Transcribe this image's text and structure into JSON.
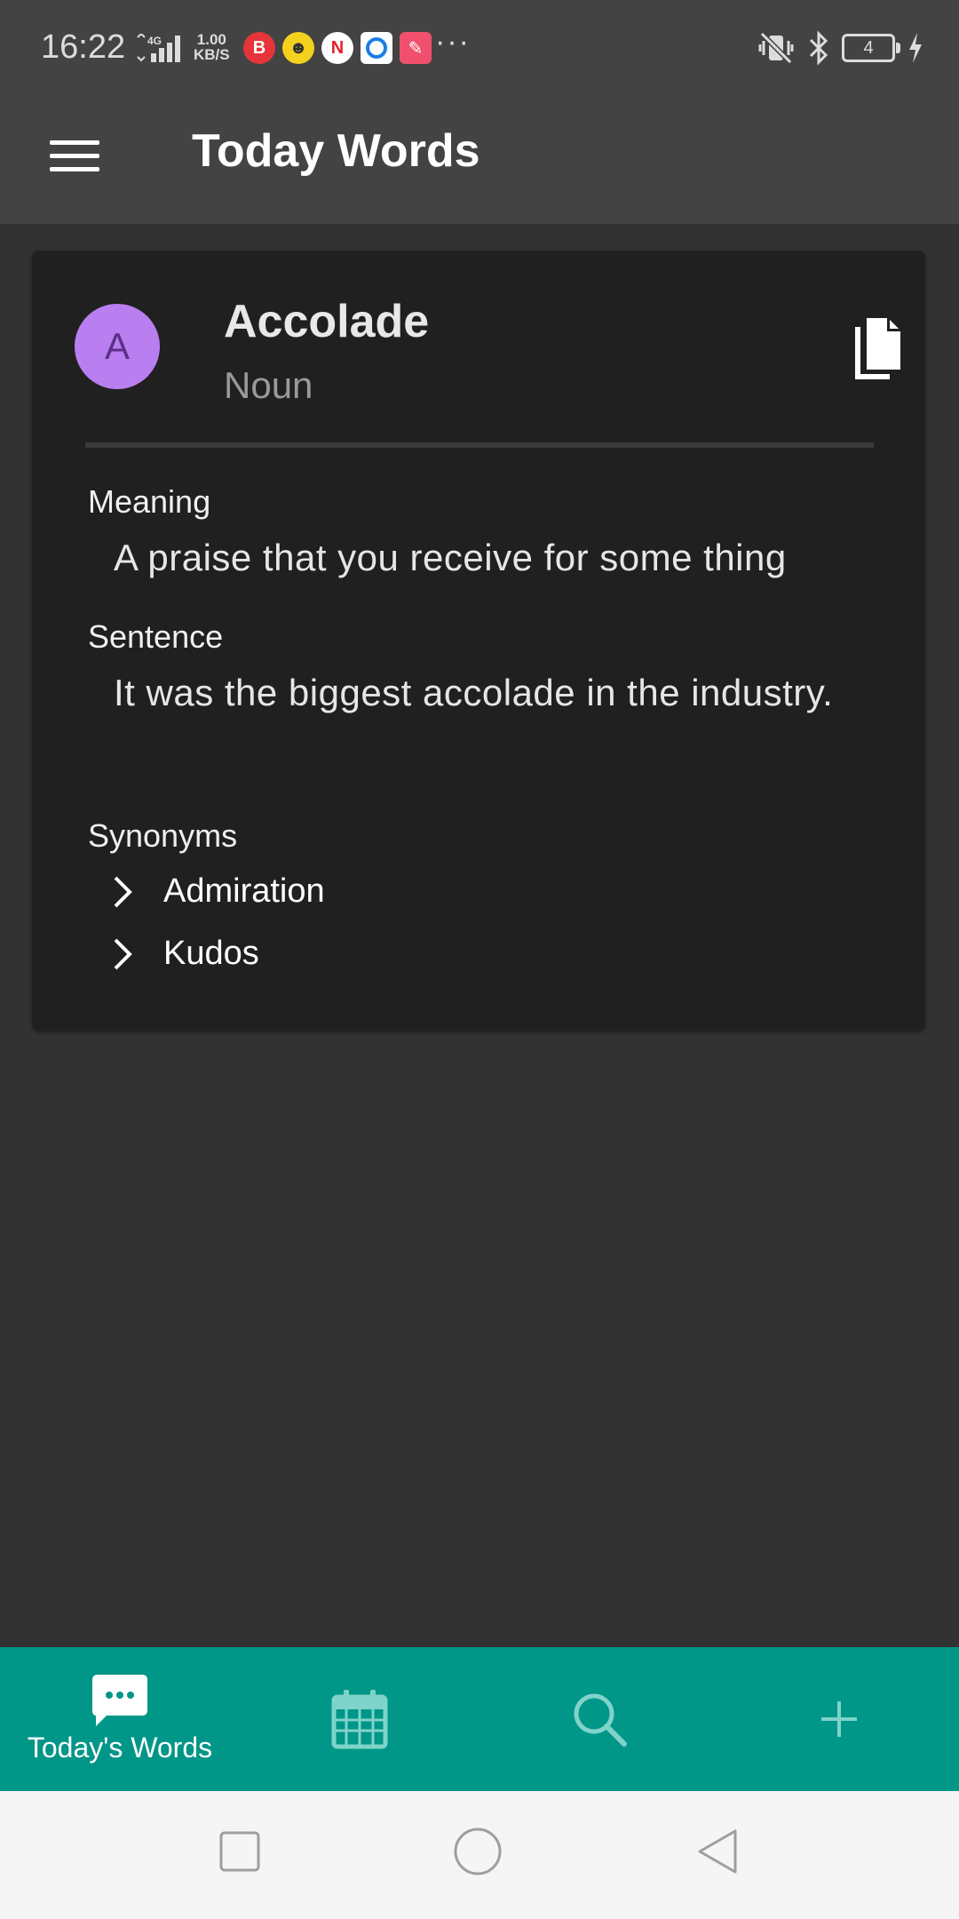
{
  "status_bar": {
    "time": "16:22",
    "speed_value": "1.00",
    "speed_unit": "KB/S",
    "net_label": "4G",
    "battery": "4",
    "more": "···"
  },
  "app_bar": {
    "title": "Today Words"
  },
  "word_card": {
    "avatar_letter": "A",
    "avatar_color": "#b97ef0",
    "word": "Accolade",
    "part_of_speech": "Noun",
    "meaning_label": "Meaning",
    "meaning": "A praise that you receive for some thing",
    "sentence_label": "Sentence",
    "sentence": "It was the biggest accolade in the industry.",
    "synonyms_label": "Synonyms",
    "synonyms": [
      "Admiration",
      "Kudos"
    ]
  },
  "bottom_nav": {
    "accent": "#009688",
    "items": [
      {
        "label": "Today's Words",
        "icon": "chat-icon"
      },
      {
        "label": "",
        "icon": "calendar-icon"
      },
      {
        "label": "",
        "icon": "search-icon"
      },
      {
        "label": "",
        "icon": "add-icon"
      }
    ]
  }
}
